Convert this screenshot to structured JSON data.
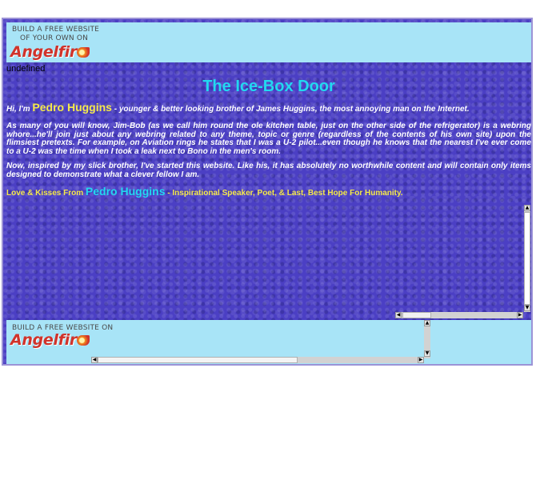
{
  "top_ad": {
    "line1": "BUILD A FREE WEBSITE",
    "line2": "OF YOUR OWN ON",
    "logo": "Angelfire"
  },
  "undefined_text": "undefined",
  "page": {
    "title": "The Ice-Box Door",
    "intro_prefix": "Hi, I'm ",
    "intro_name": "Pedro Huggins",
    "intro_rest": " - younger & better looking brother of James Huggins, the most annoying man on the Internet.",
    "para2": "As many of you will know, Jim-Bob (as we call him round the ole kitchen table, just on the other side of the refrigerator) is a webring whore...he'll join just about any webring related to any theme, topic or genre (regardless of the contents of his own site) upon the flimsiest pretexts.  For example, on Aviation rings he states that I was a U-2 pilot...even though he knows that the nearest I've ever come to a U-2 was the time when I took a leak next to Bono in the men's room.",
    "para3": "Now, inspired by my slick brother, I've started this website.  Like his, it has absolutely no worthwhile content and will contain only items designed to demonstrate what a clever fellow I am.",
    "signoff_prefix": "Love & Kisses From ",
    "signoff_name": "Pedro Huggins",
    "signoff_rest": " - Inspirational Speaker, Poet, & Last, Best Hope For Humanity."
  },
  "bottom_ad": {
    "line1": "BUILD A FREE WEBSITE ON",
    "logo": "Angelfire"
  },
  "colors": {
    "background": "#4b3fc4",
    "ad_background": "#a8e4f7",
    "title": "#22d8f0",
    "name_highlight": "#f5e94a",
    "signoff_text": "#f5e94a"
  },
  "icons": [
    "angelfire-logo-icon",
    "scroll-up-icon",
    "scroll-down-icon",
    "scroll-left-icon",
    "scroll-right-icon"
  ]
}
